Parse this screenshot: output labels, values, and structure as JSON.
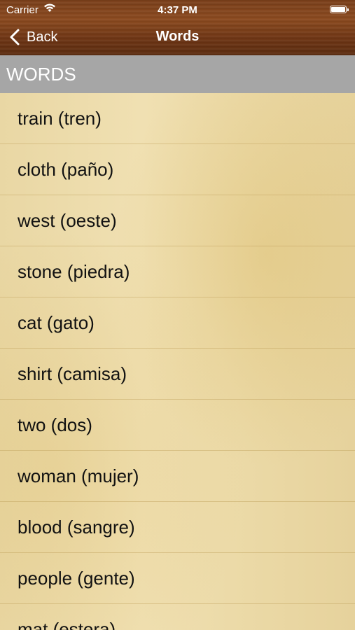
{
  "status_bar": {
    "carrier": "Carrier",
    "time": "4:37 PM"
  },
  "nav": {
    "back_label": "Back",
    "title": "Words"
  },
  "section": {
    "title": "WORDS"
  },
  "words": [
    "train (tren)",
    "cloth (paño)",
    "west (oeste)",
    "stone (piedra)",
    "cat (gato)",
    "shirt (camisa)",
    "two (dos)",
    "woman (mujer)",
    "blood (sangre)",
    "people (gente)",
    "mat (estera)"
  ],
  "colors": {
    "section_bg": "#a6a6a6",
    "nav_wood": "#7a3f1a",
    "list_paper": "#ecdaa6"
  }
}
